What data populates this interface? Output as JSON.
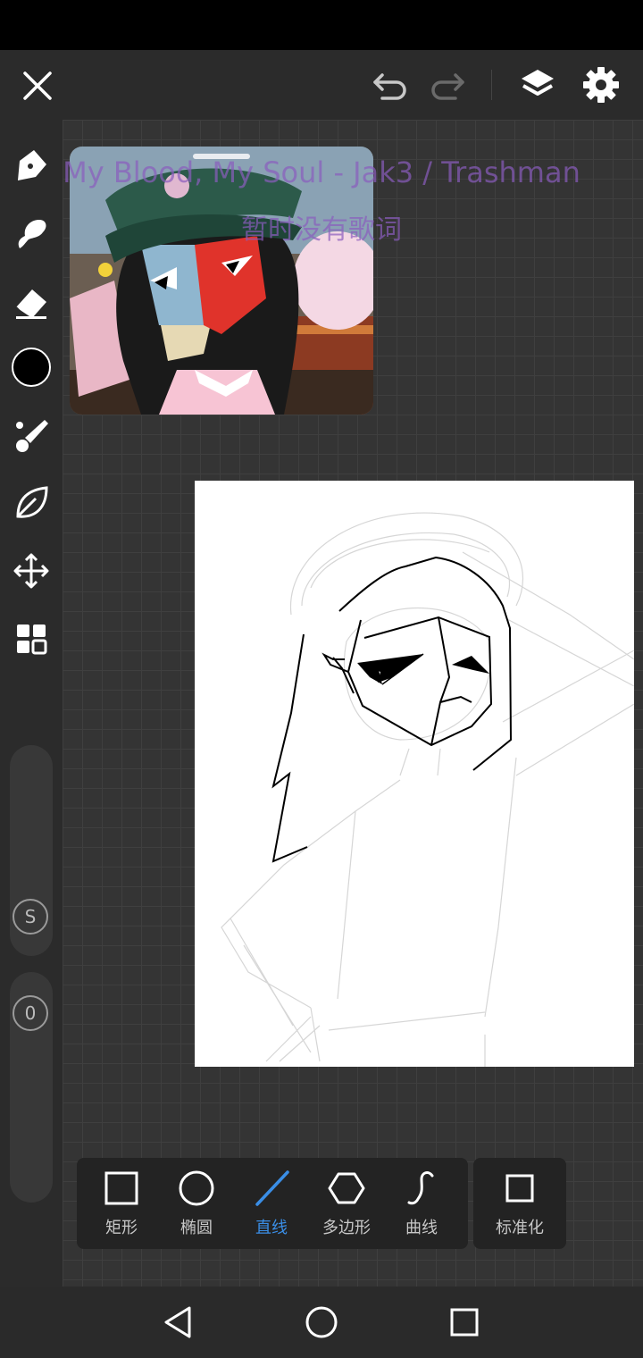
{
  "top_bar": {
    "close_icon": "close-icon",
    "undo_icon": "undo-icon",
    "redo_icon": "redo-icon",
    "layers_icon": "layers-icon",
    "settings_icon": "settings-icon"
  },
  "left_toolbar": {
    "tools": [
      "pen-tool-icon",
      "smudge-icon",
      "eraser-icon",
      "color-swatch",
      "brush-icon",
      "leaf-icon",
      "move-icon",
      "grid-icon"
    ],
    "active_color": "#000000",
    "size_slider_label": "S",
    "opacity_slider_label": "0"
  },
  "lyrics": {
    "song": "My Blood, My Soul - Jak3 / Trashman",
    "status": "暂时没有歌词"
  },
  "shape_panel": {
    "items": [
      {
        "label": "矩形",
        "icon": "rectangle-icon"
      },
      {
        "label": "椭圆",
        "icon": "ellipse-icon"
      },
      {
        "label": "直线",
        "icon": "line-icon",
        "active": true
      },
      {
        "label": "多边形",
        "icon": "polygon-icon"
      },
      {
        "label": "曲线",
        "icon": "curve-icon"
      }
    ],
    "standardize_label": "标准化"
  },
  "colors": {
    "accent": "#3a8ee6",
    "background": "#2b2b2b"
  },
  "nav_bar": {
    "back_icon": "back-icon",
    "home_icon": "home-icon",
    "recents_icon": "recents-icon"
  }
}
